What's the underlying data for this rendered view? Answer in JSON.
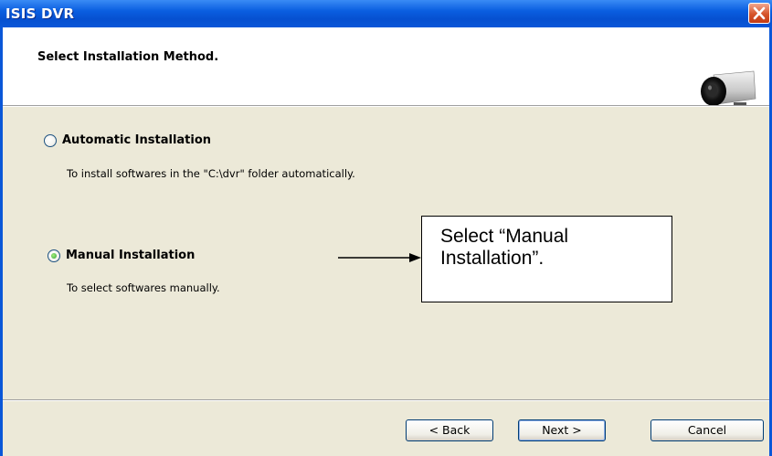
{
  "window": {
    "title": "ISIS DVR",
    "close_icon": "close-icon"
  },
  "header": {
    "title": "Select Installation Method.",
    "icon": "camera-icon"
  },
  "options": [
    {
      "label": "Automatic Installation",
      "description": "To install softwares in the \"C:\\dvr\" folder automatically.",
      "checked": false
    },
    {
      "label": "Manual Installation",
      "description": "To select softwares manually.",
      "checked": true
    }
  ],
  "annotation": {
    "text": "Select “Manual Installation”."
  },
  "buttons": {
    "back": "< Back",
    "next": "Next >",
    "cancel": "Cancel"
  },
  "colors": {
    "titlebar": "#0a57d8",
    "dialog_bg": "#ece9d8",
    "close_button": "#d6542a"
  }
}
